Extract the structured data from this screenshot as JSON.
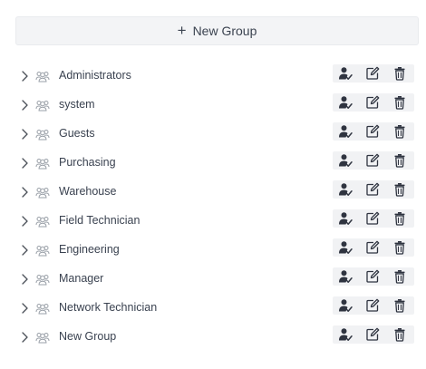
{
  "toolbar": {
    "new_group_label": "New Group"
  },
  "icons": {
    "expand": "chevron-right-icon",
    "group": "users-icon",
    "members": "user-check-icon",
    "edit": "edit-icon",
    "delete": "trash-icon"
  },
  "colors": {
    "button_bg": "#f3f4f6",
    "text": "#3a4250",
    "icon": "#2f3440",
    "muted_icon": "#9aa0a8"
  },
  "groups": [
    {
      "name": "Administrators"
    },
    {
      "name": "system"
    },
    {
      "name": "Guests"
    },
    {
      "name": "Purchasing"
    },
    {
      "name": "Warehouse"
    },
    {
      "name": "Field Technician"
    },
    {
      "name": "Engineering"
    },
    {
      "name": "Manager"
    },
    {
      "name": "Network Technician"
    },
    {
      "name": "New Group"
    }
  ]
}
